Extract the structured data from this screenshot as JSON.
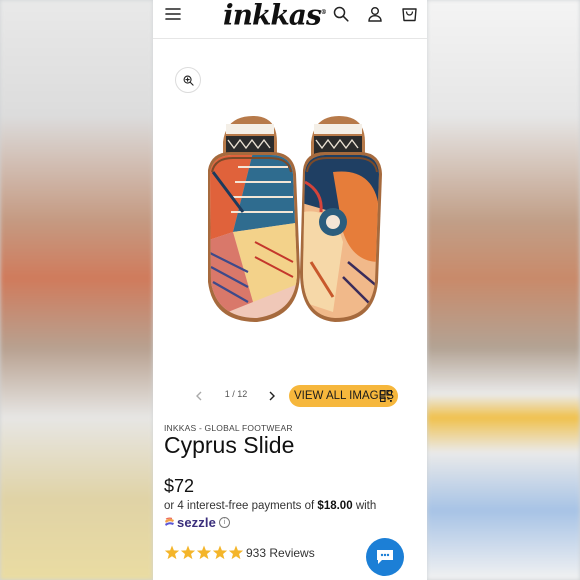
{
  "header": {
    "menu_icon": "hamburger-icon",
    "logo_text": "inkkas",
    "logo_mark": "®",
    "search_icon": "search-icon",
    "account_icon": "user-icon",
    "cart_icon": "bag-icon"
  },
  "gallery": {
    "zoom_icon": "zoom-in-icon",
    "prev_icon": "chevron-left-icon",
    "next_icon": "chevron-right-icon",
    "counter": "1 / 12",
    "view_all_label": "VIEW ALL IMAGES",
    "view_all_icon": "qr-grid-icon"
  },
  "product": {
    "brand": "INKKAS - GLOBAL FOOTWEAR",
    "title": "Cyprus Slide",
    "price": "$72",
    "installment_prefix": "or 4 interest-free payments of",
    "installment_amount": "$18.00",
    "installment_suffix": "with",
    "sezzle_label": "sezzle",
    "info_icon": "info-icon",
    "rating": 5,
    "reviews_text": "933 Reviews"
  },
  "chat": {
    "icon": "chat-bubble-icon"
  },
  "colors": {
    "accent": "#f6b73c",
    "chat": "#1c7fd6",
    "star": "#f4b52a",
    "sezzle": "#3b2f7c"
  }
}
